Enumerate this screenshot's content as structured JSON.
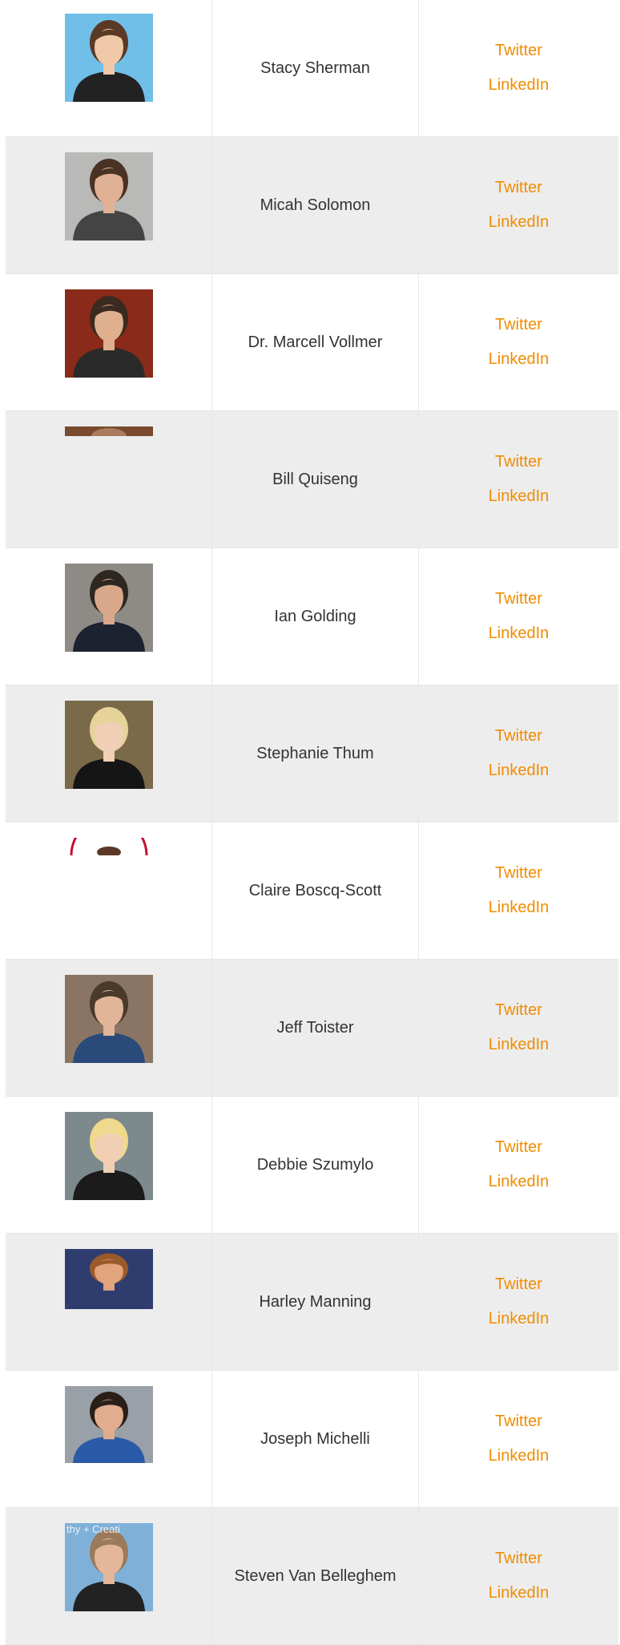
{
  "people": [
    {
      "name": "Stacy Sherman",
      "twitter_label": "Twitter",
      "linkedin_label": "LinkedIn",
      "photo": "full",
      "bg": "#6fbfe8",
      "skin": "#f0c9a8",
      "hair": "#5a3a26",
      "shirt": "#222222"
    },
    {
      "name": "Micah Solomon",
      "twitter_label": "Twitter",
      "linkedin_label": "LinkedIn",
      "photo": "full",
      "bg": "#b9bab7",
      "skin": "#e1b196",
      "hair": "#4a3325",
      "shirt": "#444444"
    },
    {
      "name": "Dr. Marcell Vollmer",
      "twitter_label": "Twitter",
      "linkedin_label": "LinkedIn",
      "photo": "full",
      "bg": "#8a2a1a",
      "skin": "#e0b08e",
      "hair": "#3a2a20",
      "shirt": "#2a2a2a"
    },
    {
      "name": "Bill Quiseng",
      "twitter_label": "Twitter",
      "linkedin_label": "LinkedIn",
      "photo": "strip",
      "bg": "#7a4a2e",
      "skin": "#d8b08a",
      "hair": "#5a3a26",
      "shirt": "#333333"
    },
    {
      "name": "Ian Golding",
      "twitter_label": "Twitter",
      "linkedin_label": "LinkedIn",
      "photo": "full",
      "bg": "#8e8a86",
      "skin": "#d9a88a",
      "hair": "#2e2620",
      "shirt": "#1c2230"
    },
    {
      "name": "Stephanie Thum",
      "twitter_label": "Twitter",
      "linkedin_label": "LinkedIn",
      "photo": "full",
      "bg": "#7a6a4a",
      "skin": "#efcfb6",
      "hair": "#e6d39a",
      "shirt": "#151515"
    },
    {
      "name": "Claire Boscq-Scott",
      "twitter_label": "Twitter",
      "linkedin_label": "LinkedIn",
      "photo": "arc",
      "bg": "#ffffff",
      "skin": "#d8b08a",
      "hair": "#5a3a26",
      "shirt": "#c8102e"
    },
    {
      "name": "Jeff Toister",
      "twitter_label": "Twitter",
      "linkedin_label": "LinkedIn",
      "photo": "full",
      "bg": "#8a7464",
      "skin": "#e1b597",
      "hair": "#4a3a2c",
      "shirt": "#2a4a7a"
    },
    {
      "name": "Debbie Szumylo",
      "twitter_label": "Twitter",
      "linkedin_label": "LinkedIn",
      "photo": "full",
      "bg": "#7c8a8e",
      "skin": "#f0cfb4",
      "hair": "#efd98c",
      "shirt": "#1b1b1b"
    },
    {
      "name": "Harley Manning",
      "twitter_label": "Twitter",
      "linkedin_label": "LinkedIn",
      "photo": "short",
      "bg": "#2f3d6e",
      "skin": "#e2a47c",
      "hair": "#9a5a2a",
      "shirt": "#2f3d6e"
    },
    {
      "name": "Joseph Michelli",
      "twitter_label": "Twitter",
      "linkedin_label": "LinkedIn",
      "photo": "short",
      "bg": "#9aa0a8",
      "skin": "#e2ad8e",
      "hair": "#2a1e18",
      "shirt": "#2a5aa8"
    },
    {
      "name": "Steven Van Belleghem",
      "twitter_label": "Twitter",
      "linkedin_label": "LinkedIn",
      "photo": "full",
      "bg": "#7fb0d8",
      "skin": "#e5b79a",
      "hair": "#9a7a5a",
      "shirt": "#222222",
      "bg_text": "thy + Creati"
    }
  ]
}
